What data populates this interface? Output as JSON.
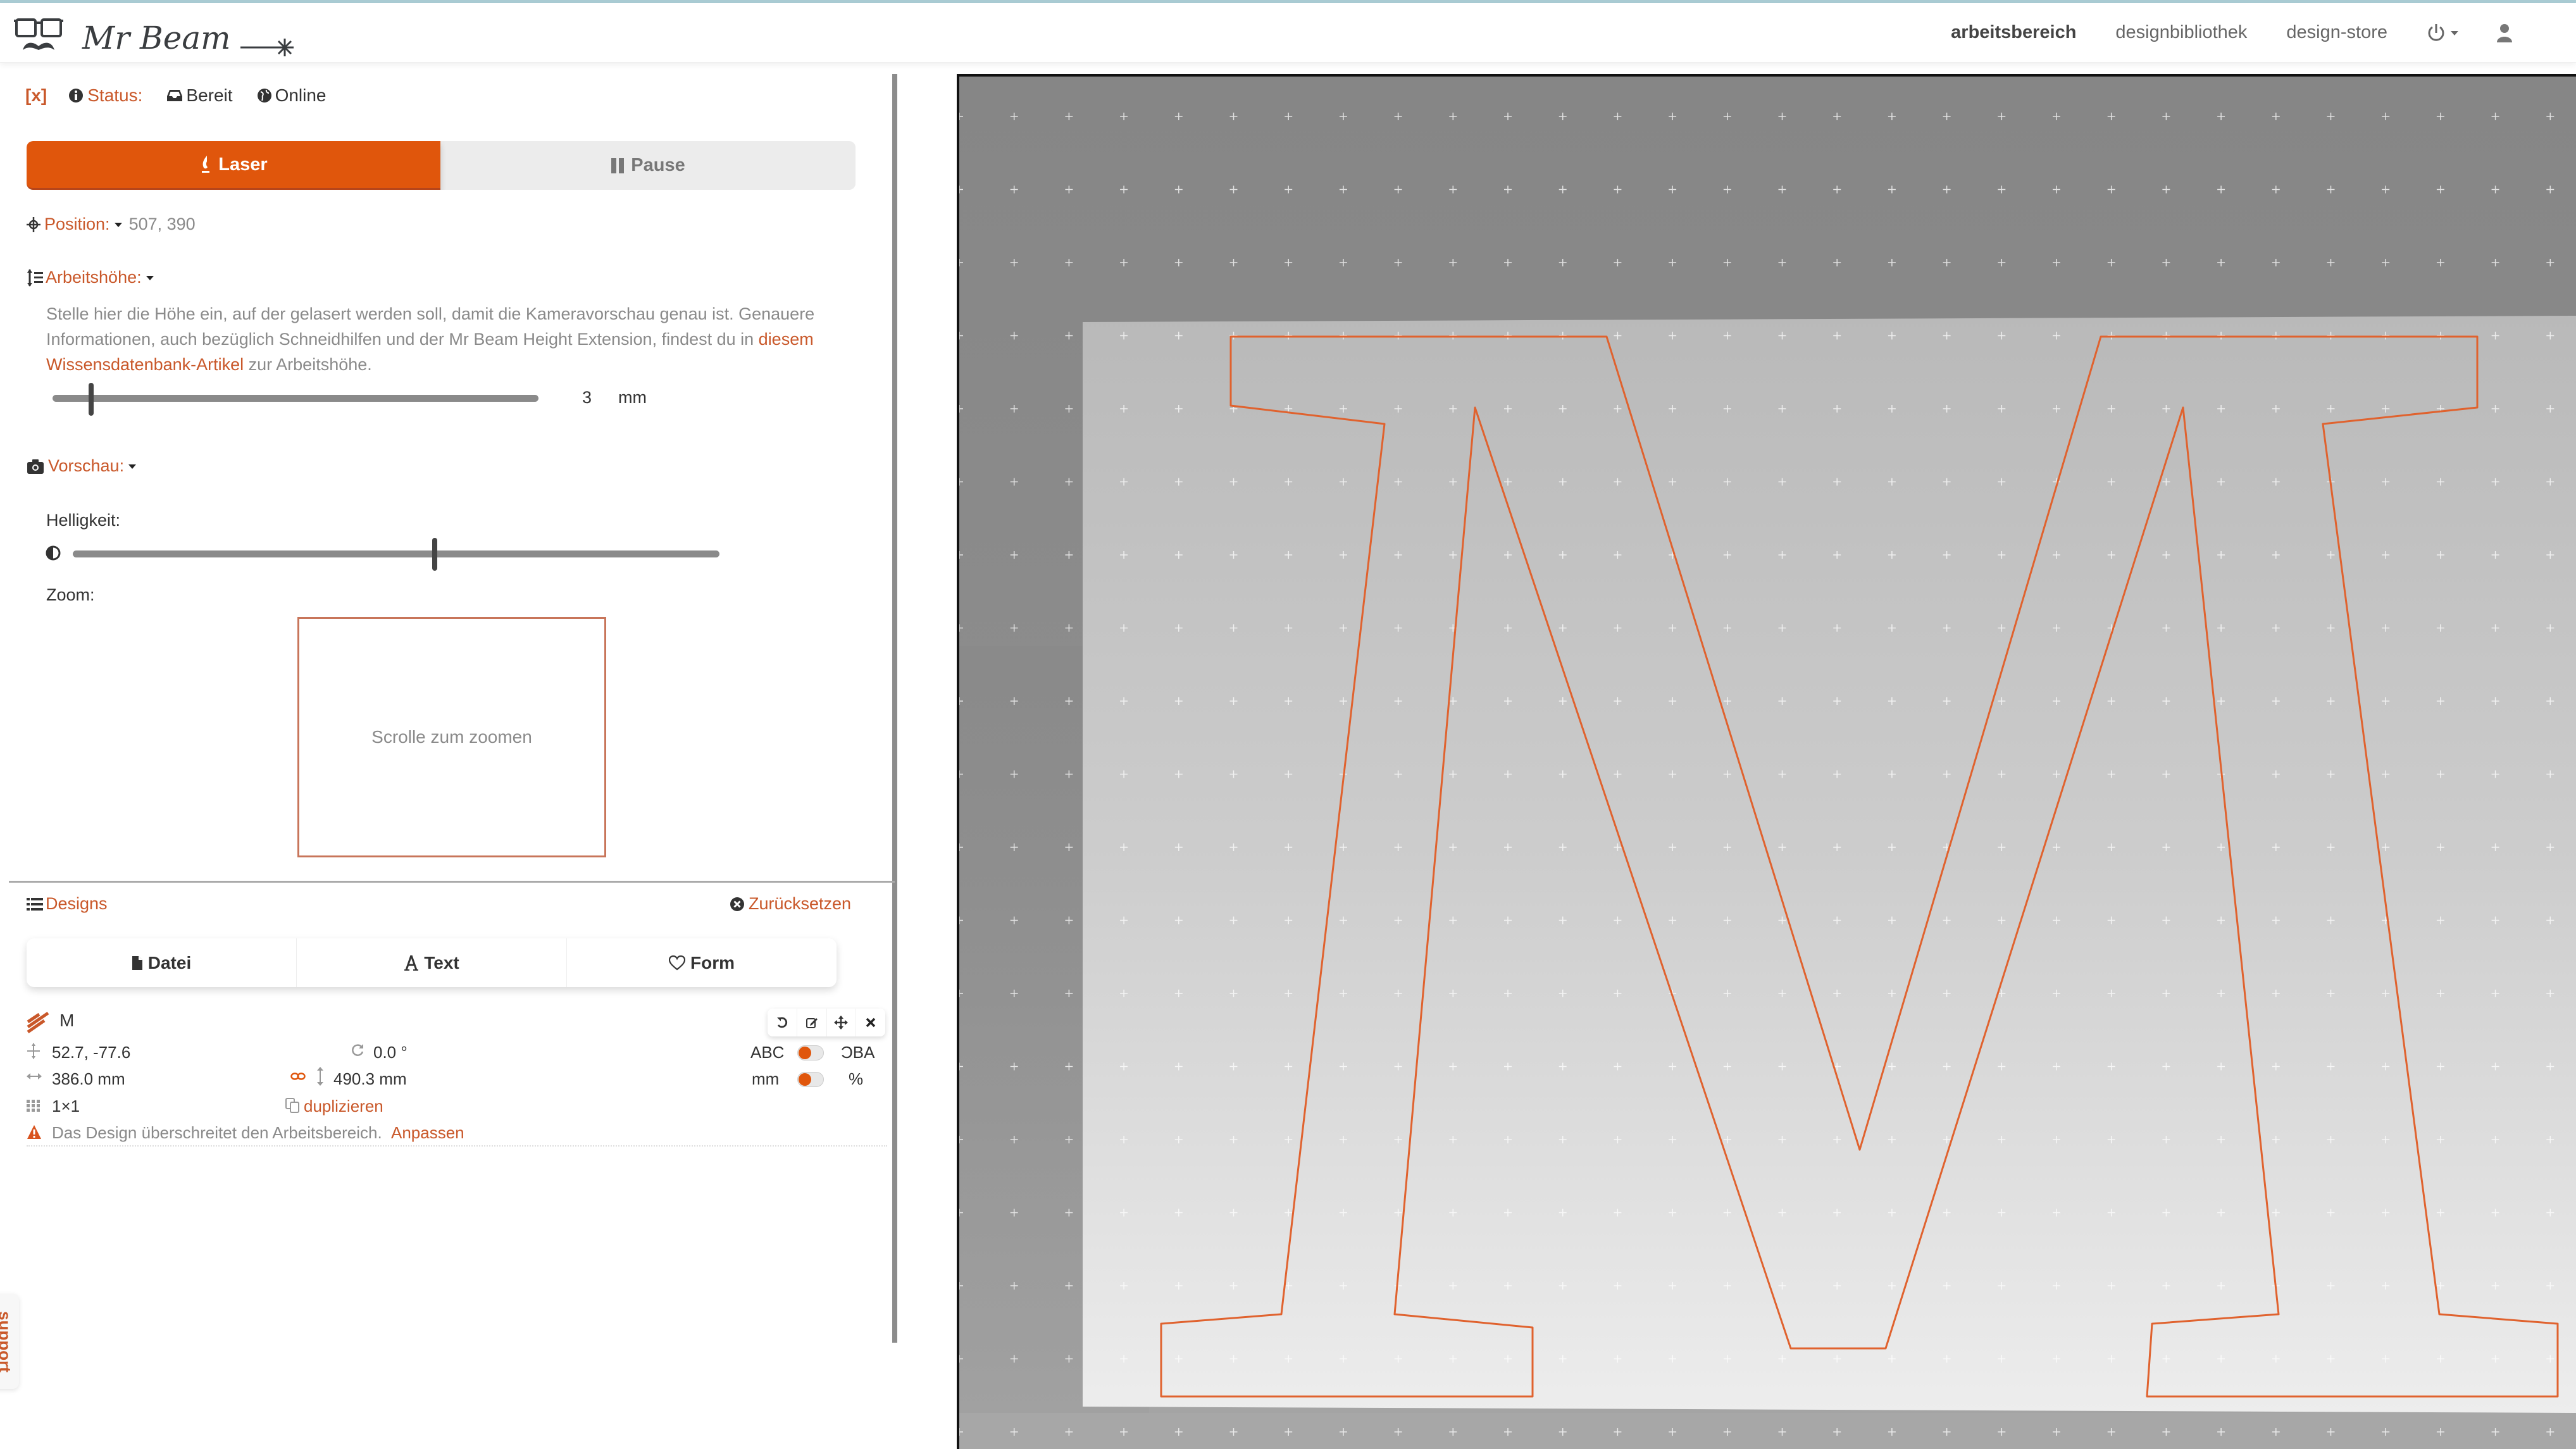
{
  "header": {
    "logo_text": "Mr Beam",
    "nav": [
      {
        "label": "arbeitsbereich",
        "active": true
      },
      {
        "label": "designbibliothek",
        "active": false
      },
      {
        "label": "design-store",
        "active": false
      }
    ],
    "icons": [
      "power-icon",
      "user-icon"
    ]
  },
  "status_bar": {
    "collapse_label": "[x]",
    "status_label": "Status:",
    "state": "Bereit",
    "connection": "Online"
  },
  "controls": {
    "laser_label": "Laser",
    "pause_label": "Pause"
  },
  "position": {
    "label": "Position:",
    "value": "507, 390"
  },
  "work_height": {
    "label": "Arbeitshöhe:",
    "description_pre": "Stelle hier die Höhe ein, auf der gelasert werden soll, damit die Kameravorschau genau ist. Genauere Informationen, auch bezüglich Schneidhilfen und der Mr Beam Height Extension, findest du in ",
    "link_text": "diesem Wissensdatenbank-Artikel",
    "description_post": " zur Arbeitshöhe.",
    "value": "3",
    "unit": "mm",
    "slider_fraction": 0.08
  },
  "preview": {
    "label": "Vorschau:",
    "brightness_label": "Helligkeit:",
    "brightness_fraction": 0.56,
    "zoom_label": "Zoom:",
    "zoom_hint": "Scrolle zum zoomen"
  },
  "designs": {
    "title": "Designs",
    "reset_label": "Zurücksetzen",
    "add_buttons": [
      {
        "label": "Datei",
        "icon": "file-icon"
      },
      {
        "label": "Text",
        "icon": "font-icon"
      },
      {
        "label": "Form",
        "icon": "heart-icon"
      }
    ],
    "items": [
      {
        "name": "M",
        "position": "52.7, -77.6",
        "rotation": "0.0 °",
        "width": "386.0 mm",
        "height": "490.3 mm",
        "multiply": "1×1",
        "duplicate_label": "duplizieren",
        "mirror_left": "ABC",
        "mirror_right": "ƆBA",
        "unit_left": "mm",
        "unit_right": "%",
        "warning": "Das Design überschreitet den Arbeitsbereich.",
        "fix_label": "Anpassen"
      }
    ]
  },
  "support_label": "support",
  "colors": {
    "accent": "#e0560c",
    "accent_text": "#c9582a",
    "outline": "#e0622e"
  }
}
